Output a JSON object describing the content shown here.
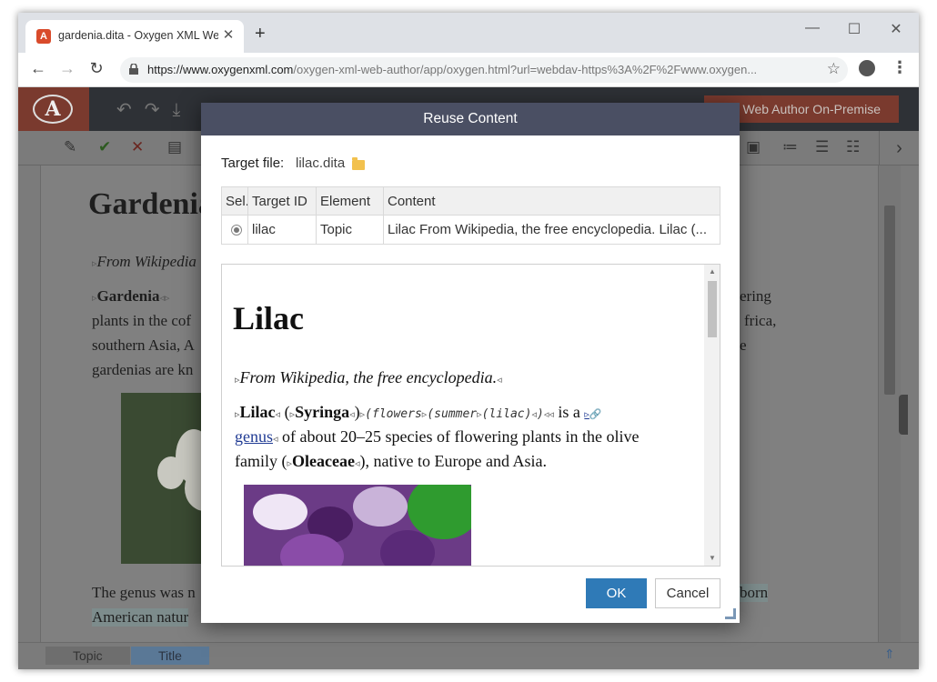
{
  "browser": {
    "tab_title": "gardenia.dita - Oxygen XML Web Author",
    "tab_close_icon": "close-icon",
    "new_tab": "+",
    "url_main": "https://www.oxygenxml.com",
    "url_rest": "/oxygen-xml-web-author/app/oxygen.html?url=webdav-https%3A%2F%2Fwww.oxygen..."
  },
  "app": {
    "banner": "Web Author On-Premise",
    "document": {
      "title": "Gardenia",
      "line1": "From Wikipedia",
      "line2_bold": "Gardenia",
      "line2_right": "ering",
      "line3_left": "plants in the cof",
      "line3_right": "frica,",
      "line4_left": "southern Asia, A",
      "line4_right": "e",
      "line5_left": "gardenias are kn",
      "line6_left": "The genus was n",
      "line6_right": "born",
      "line7_left": "American natur"
    },
    "breadcrumb": [
      "Topic",
      "Title"
    ]
  },
  "dialog": {
    "title": "Reuse Content",
    "target_label": "Target file:",
    "target_file": "lilac.dita",
    "columns": [
      "Sel.",
      "Target ID",
      "Element",
      "Content"
    ],
    "rows": [
      {
        "target_id": "lilac",
        "element": "Topic",
        "content": "Lilac From Wikipedia, the free encyclopedia. Lilac (..."
      }
    ],
    "preview": {
      "title": "Lilac",
      "shortdesc": "From Wikipedia, the free encyclopedia.",
      "p1_bold": "Lilac",
      "p1_syringa": "Syringa",
      "p1_mono": "(flowers",
      "p1_mono2": "(summer",
      "p1_mono3": "(lilac)",
      "p1_tail": " is a ",
      "p1_link": "genus",
      "p1_rest": " of about 20–25 species of flowering plants in the olive",
      "p2_start": "family (",
      "p2_bold": "Oleaceae",
      "p2_end": "), native to Europe and Asia."
    },
    "ok_label": "OK",
    "cancel_label": "Cancel"
  }
}
